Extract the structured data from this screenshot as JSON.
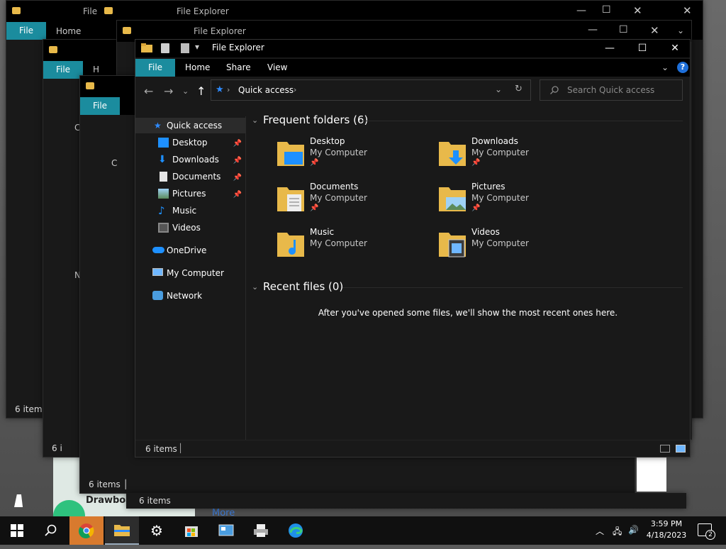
{
  "main_window": {
    "title": "File Explorer",
    "ribbon_tabs": [
      "File",
      "Home",
      "Share",
      "View"
    ],
    "address": "Quick access",
    "search_placeholder": "Search Quick access",
    "nav": [
      {
        "label": "Quick access",
        "icon": "star-icon"
      },
      {
        "label": "Desktop",
        "icon": "desktop-icon",
        "pinned": true
      },
      {
        "label": "Downloads",
        "icon": "download-icon",
        "pinned": true
      },
      {
        "label": "Documents",
        "icon": "document-icon",
        "pinned": true
      },
      {
        "label": "Pictures",
        "icon": "picture-icon",
        "pinned": true
      },
      {
        "label": "Music",
        "icon": "music-icon"
      },
      {
        "label": "Videos",
        "icon": "video-icon"
      },
      {
        "label": "OneDrive",
        "icon": "cloud-icon"
      },
      {
        "label": "My Computer",
        "icon": "computer-icon"
      },
      {
        "label": "Network",
        "icon": "network-icon"
      }
    ],
    "frequent_title": "Frequent folders (6)",
    "frequent": [
      {
        "name": "Desktop",
        "location": "My Computer",
        "pinned": true
      },
      {
        "name": "Downloads",
        "location": "My Computer",
        "pinned": true
      },
      {
        "name": "Documents",
        "location": "My Computer",
        "pinned": true
      },
      {
        "name": "Pictures",
        "location": "My Computer",
        "pinned": true
      },
      {
        "name": "Music",
        "location": "My Computer",
        "pinned": false
      },
      {
        "name": "Videos",
        "location": "My Computer",
        "pinned": false
      }
    ],
    "recent_title": "Recent files (0)",
    "recent_message": "After you've opened some files, we'll show the most recent ones here.",
    "status": "6 items"
  },
  "background_windows": {
    "title": "File Explorer",
    "file_tab": "File",
    "home_tab": "Home",
    "status": "6 items",
    "partial_texts": [
      "File",
      "H",
      "C",
      "N",
      "6 i",
      "6 items"
    ]
  },
  "desktop": {
    "card_text": "Drawboa",
    "more_link": "More"
  },
  "taskbar": {
    "time": "3:59 PM",
    "date": "4/18/2023",
    "notification_count": "2"
  },
  "colors": {
    "accent": "#1b8c9e",
    "folder": "#e8b94a",
    "icon_blue": "#1e90ff"
  }
}
